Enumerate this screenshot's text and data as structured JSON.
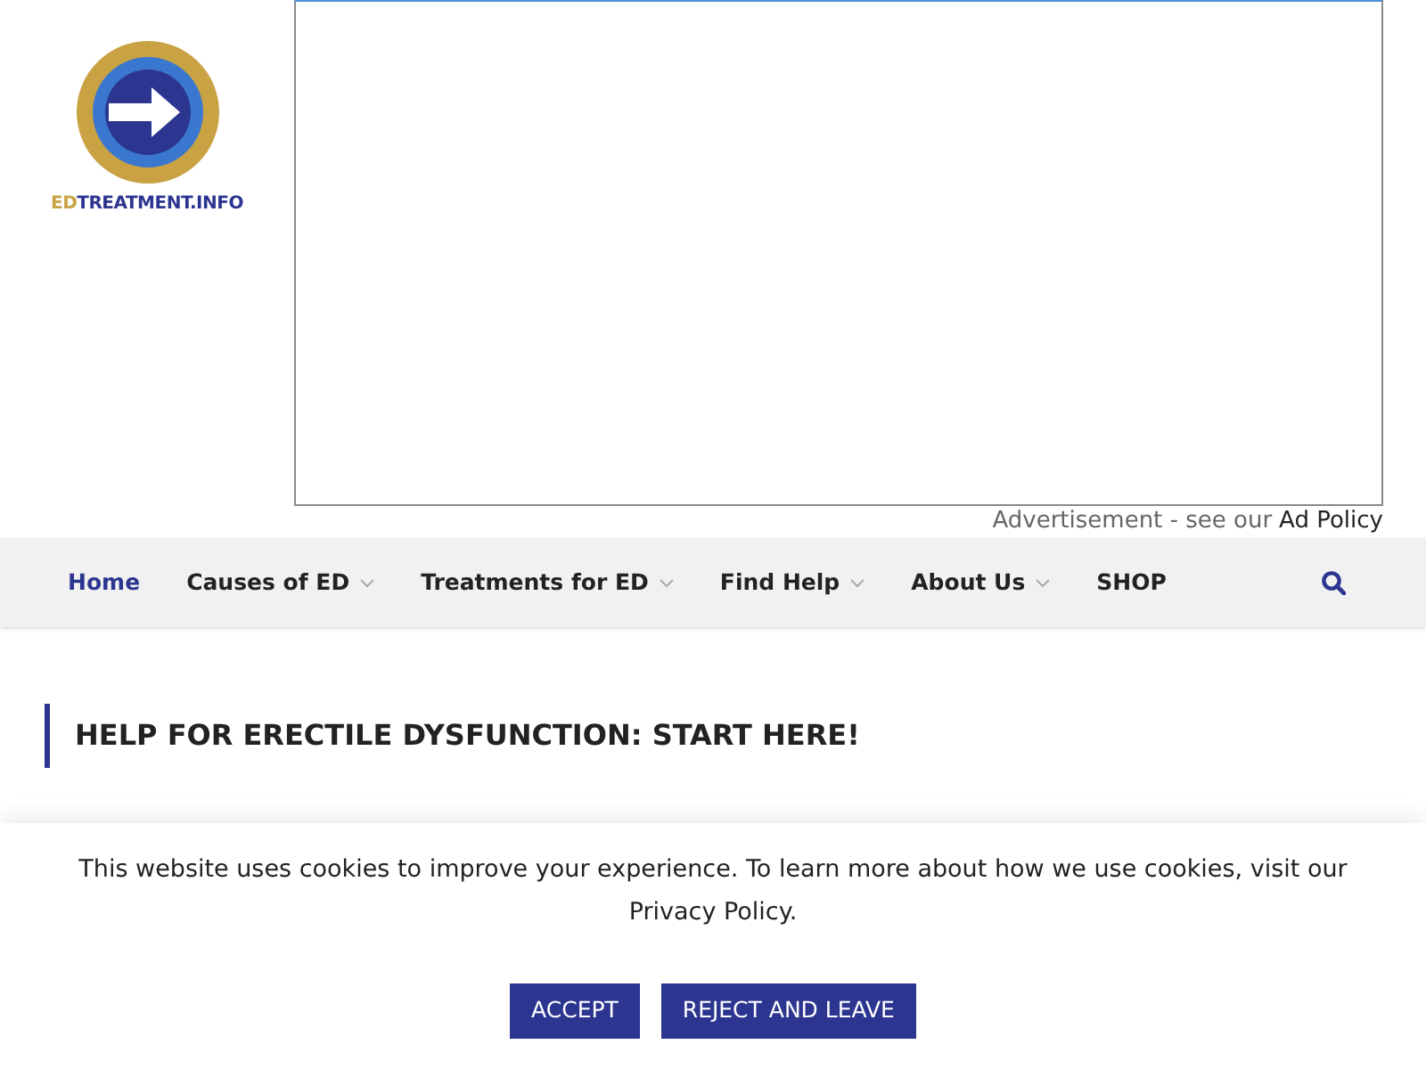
{
  "logo": {
    "prefix": "ED",
    "suffix": "TREATMENT.INFO"
  },
  "ad": {
    "label": "Advertisement - see our",
    "link": "Ad Policy"
  },
  "nav": {
    "items": [
      {
        "label": "Home",
        "selected": true,
        "dropdown": false
      },
      {
        "label": "Causes of ED",
        "selected": false,
        "dropdown": true
      },
      {
        "label": "Treatments for ED",
        "selected": false,
        "dropdown": true
      },
      {
        "label": "Find Help",
        "selected": false,
        "dropdown": true
      },
      {
        "label": "About Us",
        "selected": false,
        "dropdown": true
      },
      {
        "label": "SHOP",
        "selected": false,
        "dropdown": false
      }
    ]
  },
  "heading": "HELP FOR ERECTILE DYSFUNCTION: START HERE!",
  "cookie_banner": {
    "text": "This website uses cookies to improve your experience. To learn more about how we use cookies, visit our Privacy Policy.",
    "buttons": [
      "ACCEPT",
      "REJECT AND LEAVE"
    ]
  }
}
